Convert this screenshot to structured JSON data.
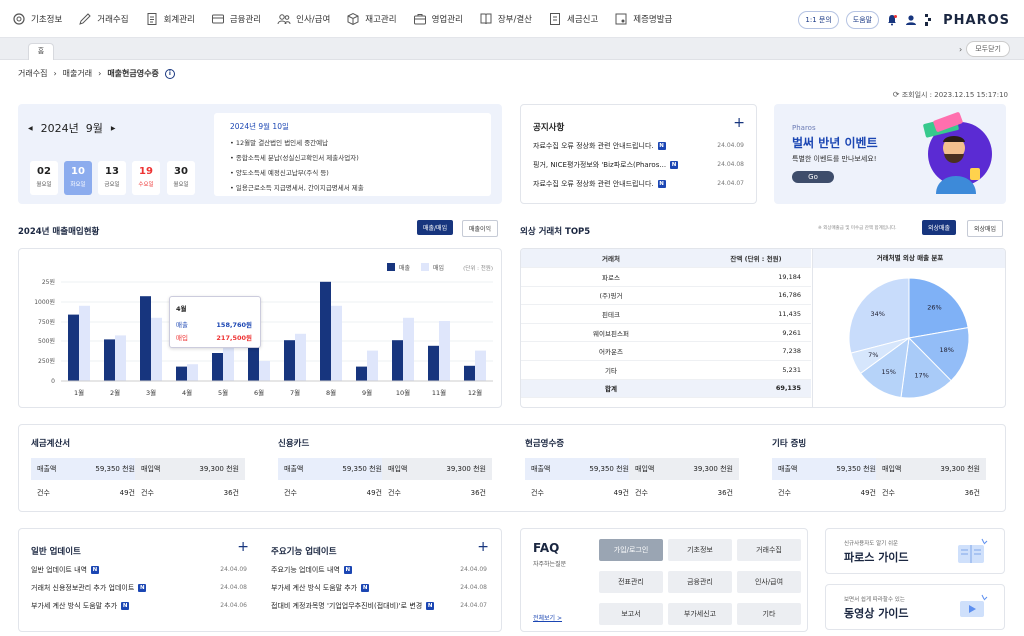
{
  "nav": {
    "items": [
      {
        "label": "기초정보",
        "icon": "gear-icon"
      },
      {
        "label": "거래수집",
        "icon": "pen-icon"
      },
      {
        "label": "회계관리",
        "icon": "document-icon"
      },
      {
        "label": "금융관리",
        "icon": "card-icon"
      },
      {
        "label": "인사/급여",
        "icon": "people-icon"
      },
      {
        "label": "재고관리",
        "icon": "box-icon"
      },
      {
        "label": "영업관리",
        "icon": "briefcase-icon"
      },
      {
        "label": "장부/결산",
        "icon": "book-icon"
      },
      {
        "label": "세금신고",
        "icon": "tax-icon"
      },
      {
        "label": "제증명발급",
        "icon": "certificate-icon"
      }
    ],
    "inquiry": "1:1 문의",
    "help": "도움말",
    "logo": "PHAROS"
  },
  "tabs": {
    "home": "홈",
    "close_all": "모두닫기"
  },
  "breadcrumb": [
    "거래수집",
    "매출거래",
    "매출현금영수증"
  ],
  "lookup": "조회일시 : 2023.12.15 15:17:10",
  "calendar": {
    "month": "2024년  9월",
    "days": [
      {
        "num": "02",
        "label": "월요일"
      },
      {
        "num": "10",
        "label": "화요일"
      },
      {
        "num": "13",
        "label": "금요일"
      },
      {
        "num": "19",
        "label": "수요일"
      },
      {
        "num": "30",
        "label": "월요일"
      }
    ],
    "selected_date": "2024년 9월 10일",
    "events": [
      "12월말 결산법인 법인세 중간예납",
      "종합소득세 분납(성실신고확인서 제출사업자)",
      "양도소득세 예정신고납부(주식 등)",
      "일용근로소득 지급명세서, 간이지급명세서 제출"
    ]
  },
  "notice": {
    "title": "공지사항",
    "items": [
      {
        "text": "자료수집 오류 정상화 관련 안내드립니다.",
        "date": "24.04.09"
      },
      {
        "text": "핑거, NICE평가정보와 'Biz파로스(Pharos...",
        "date": "24.04.08"
      },
      {
        "text": "자료수집 오류 정상화 관련 안내드립니다.",
        "date": "24.04.07"
      }
    ]
  },
  "banner": {
    "brand": "Pharos",
    "headline": "벌써 반년 이벤트",
    "sub": "특별한 이벤트를 만나보세요!",
    "go": "Go"
  },
  "sales": {
    "title": "2024년 매출매입현황",
    "btn_active": "매출/매입",
    "btn_other": "매출이익"
  },
  "chart_data": {
    "type": "bar",
    "categories": [
      "1월",
      "2월",
      "3월",
      "4월",
      "5월",
      "6월",
      "7월",
      "8월",
      "9월",
      "10월",
      "11월",
      "12월"
    ],
    "series": [
      {
        "name": "매출",
        "values": [
          830,
          520,
          1060,
          180,
          350,
          580,
          510,
          1240,
          180,
          510,
          440,
          190
        ]
      },
      {
        "name": "매입",
        "values": [
          940,
          570,
          790,
          210,
          560,
          250,
          590,
          940,
          380,
          790,
          750,
          380
        ]
      }
    ],
    "unit_label": "(단위 : 천원)",
    "ylim": [
      0,
      1250
    ],
    "yticks": [
      "0",
      "250원",
      "500원",
      "750원",
      "1000원",
      "25원"
    ],
    "tooltip": {
      "month": "4월",
      "label1": "매출",
      "value1": "158,760원",
      "label2": "매입",
      "value2": "217,500원"
    },
    "colors": {
      "sales": "#17357e",
      "purchase": "#dfe6fb"
    }
  },
  "top5": {
    "title": "외상 거래처 TOP5",
    "hint": "※ 외상매출금 및 미수금 잔액 합계입니다.",
    "btn_active": "외상매출",
    "btn_other": "외상매입",
    "headers": [
      "거래처",
      "잔액 (단위 : 천원)",
      "거래처별 외상 매출 분포"
    ],
    "rows": [
      {
        "name": "파로스",
        "amount": "19,184"
      },
      {
        "name": "(주)핑거",
        "amount": "16,786"
      },
      {
        "name": "핀테크",
        "amount": "11,435"
      },
      {
        "name": "웨이브핀스퍼",
        "amount": "9,261"
      },
      {
        "name": "어카운즈",
        "amount": "7,238"
      },
      {
        "name": "기타",
        "amount": "5,231"
      }
    ],
    "total_label": "합계",
    "total": "69,135",
    "pie": [
      {
        "label": "34%",
        "value": 34,
        "color": "#c8dcfb"
      },
      {
        "label": "26%",
        "value": 26,
        "color": "#7fb1f6"
      },
      {
        "label": "18%",
        "value": 18,
        "color": "#93bdf7"
      },
      {
        "label": "17%",
        "value": 17,
        "color": "#a9cbf8"
      },
      {
        "label": "15%",
        "value": 15,
        "color": "#b6d3f9"
      },
      {
        "label": "7%",
        "value": 7,
        "color": "#d6e6fc"
      }
    ]
  },
  "summaries": [
    {
      "title": "세금계산서",
      "sales_label": "매출액",
      "sales": "59,350 천원",
      "purchase_label": "매입액",
      "purchase": "39,300 천원",
      "count_label": "건수",
      "sales_count": "49건",
      "purchase_count": "36건"
    },
    {
      "title": "신용카드",
      "sales_label": "매출액",
      "sales": "59,350 천원",
      "purchase_label": "매입액",
      "purchase": "39,300 천원",
      "count_label": "건수",
      "sales_count": "49건",
      "purchase_count": "36건"
    },
    {
      "title": "현금영수증",
      "sales_label": "매출액",
      "sales": "59,350 천원",
      "purchase_label": "매입액",
      "purchase": "39,300 천원",
      "count_label": "건수",
      "sales_count": "49건",
      "purchase_count": "36건"
    },
    {
      "title": "기타 증빙",
      "sales_label": "매출액",
      "sales": "59,350 천원",
      "purchase_label": "매입액",
      "purchase": "39,300 천원",
      "count_label": "건수",
      "sales_count": "49건",
      "purchase_count": "36건"
    }
  ],
  "updates": [
    {
      "title": "일반 업데이트",
      "items": [
        {
          "text": "일반 업데이트 내역",
          "date": "24.04.09"
        },
        {
          "text": "거래처 신용정보관리 추가 업데이트",
          "date": "24.04.08"
        },
        {
          "text": "부가세 계산 방식 도움말 추가",
          "date": "24.04.06"
        }
      ]
    },
    {
      "title": "주요기능 업데이트",
      "items": [
        {
          "text": "주요기능 업데이트 내역",
          "date": "24.04.09"
        },
        {
          "text": "부가세 계산 방식 도움말 추가",
          "date": "24.04.08"
        },
        {
          "text": "접대비 계정과목명 '기업업무추진비(접대비)'로 변경",
          "date": "24.04.07"
        }
      ]
    }
  ],
  "faq": {
    "title": "FAQ",
    "sub": "자주하는질문",
    "more": "전체보기 >",
    "buttons": [
      "가입/로그인",
      "기초정보",
      "거래수집",
      "전표관리",
      "금융관리",
      "인사/급여",
      "보고서",
      "부가세신고",
      "기타"
    ]
  },
  "guides": [
    {
      "small": "신규사용자도 알기 쉬운",
      "big": "파로스 가이드"
    },
    {
      "small": "보면서 쉽게 따라할수 있는",
      "big": "동영상 가이드"
    }
  ]
}
